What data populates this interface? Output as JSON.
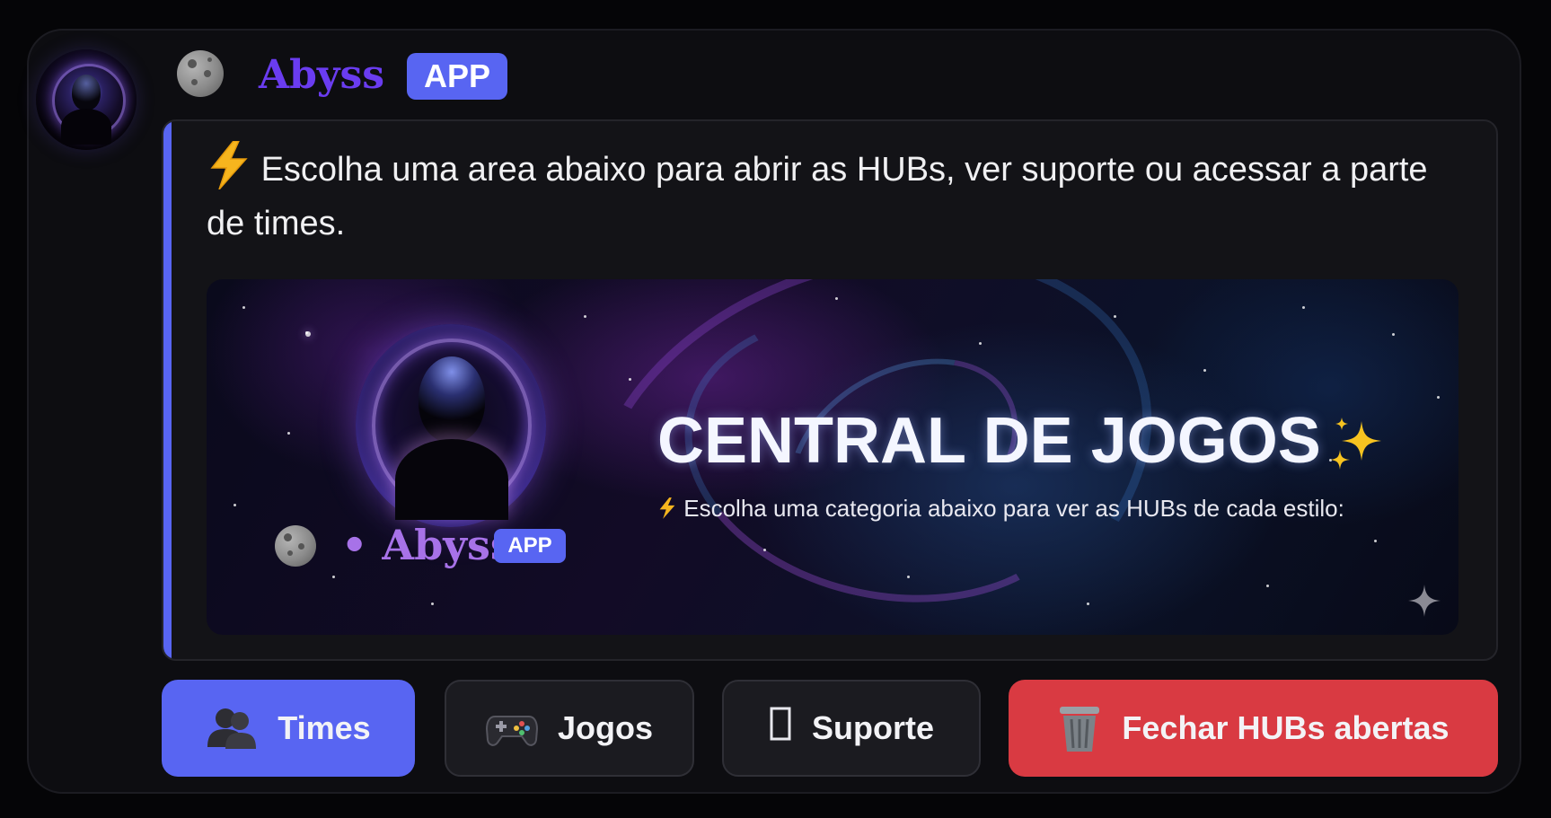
{
  "message": {
    "author": "Abyss",
    "author_badge": "APP",
    "author_color": "#6a3cf0",
    "avatar_icon": "hooded-figure-orb-icon",
    "author_icon": "moon-icon"
  },
  "embed": {
    "accent_color": "#5865f2",
    "description_icon": "lightning-icon",
    "description": "Escolha uma area abaixo para abrir as HUBs, ver suporte ou acessar a parte de times.",
    "banner": {
      "title": "CENTRAL DE JOGOS",
      "title_icon": "sparkles-icon",
      "subtitle_icon": "lightning-icon",
      "subtitle": "Escolha uma categoria abaixo para ver as HUBs de cada estilo:",
      "footer_icon": "moon-icon",
      "footer_name": "• Abyss",
      "footer_badge": "APP"
    }
  },
  "buttons": [
    {
      "label": "Times",
      "icon": "people-icon",
      "style": "primary",
      "color": "#5865f2"
    },
    {
      "label": "Jogos",
      "icon": "game-controller-icon",
      "style": "secondary",
      "color": "#1b1b20"
    },
    {
      "label": "Suporte",
      "icon": "unknown-glyph-icon",
      "style": "secondary",
      "color": "#1b1b20"
    },
    {
      "label": "Fechar HUBs abertas",
      "icon": "wastebasket-icon",
      "style": "danger",
      "color": "#d93a42"
    }
  ]
}
